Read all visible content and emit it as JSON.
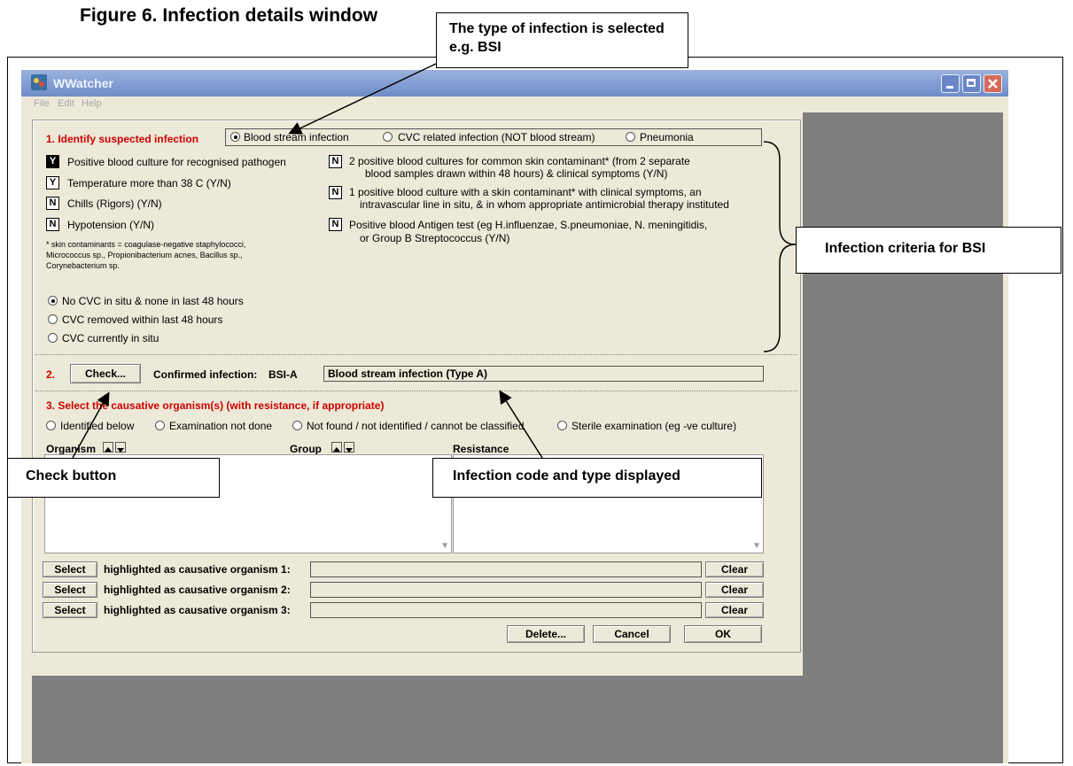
{
  "figure_title": "Figure 6. Infection details window",
  "callouts": {
    "type_selected": "The type of infection is selected e.g. BSI",
    "criteria": "Infection criteria for BSI",
    "check_button": "Check button",
    "code_type": "Infection code and type displayed"
  },
  "window": {
    "title": "WWatcher",
    "menu": [
      "File",
      "Edit",
      "Help"
    ]
  },
  "section1": {
    "label": "1. Identify suspected infection",
    "types": [
      {
        "label": "Blood stream infection",
        "selected": true
      },
      {
        "label": "CVC related infection (NOT blood stream)",
        "selected": false
      },
      {
        "label": "Pneumonia",
        "selected": false
      }
    ],
    "criteria_left": [
      {
        "value": "Y",
        "label": "Positive blood culture for recognised pathogen"
      },
      {
        "value": "Y",
        "label": "Temperature more than 38 C (Y/N)"
      },
      {
        "value": "N",
        "label": "Chills (Rigors) (Y/N)"
      },
      {
        "value": "N",
        "label": "Hypotension (Y/N)"
      }
    ],
    "criteria_right": [
      {
        "value": "N",
        "line1": "2 positive blood cultures for common skin contaminant* (from 2 separate",
        "line2": "blood samples drawn within 48 hours) & clinical symptoms (Y/N)"
      },
      {
        "value": "N",
        "line1": "1 positive blood culture with a skin contaminant* with clinical symptoms, an",
        "line2": "intravascular line in situ, & in whom appropriate antimicrobial therapy  instituted"
      },
      {
        "value": "N",
        "line1": "Positive blood Antigen test (eg H.influenzae, S.pneumoniae, N. meningitidis,",
        "line2": "or Group B Streptococcus (Y/N)"
      }
    ],
    "footnote": "* skin contaminants = coagulase-negative staphylococci, Micrococcus sp., Propionibacterium acnes, Bacillus sp., Corynebacterium sp.",
    "cvc_options": [
      {
        "label": "No CVC in situ & none in last 48 hours",
        "selected": true
      },
      {
        "label": "CVC removed within last 48 hours",
        "selected": false
      },
      {
        "label": "CVC currently in situ",
        "selected": false
      }
    ]
  },
  "section2": {
    "number": "2.",
    "check_label": "Check...",
    "confirmed_label": "Confirmed infection:",
    "code": "BSI-A",
    "type_text": "Blood stream infection (Type A)"
  },
  "section3": {
    "label": "3. Select the causative organism(s) (with resistance, if appropriate)",
    "options": [
      {
        "label": "Identified below",
        "selected": false
      },
      {
        "label": "Examination not done",
        "selected": false
      },
      {
        "label": "Not found / not identified / cannot be classified",
        "selected": false
      },
      {
        "label": "Sterile examination (eg -ve culture)",
        "selected": false
      }
    ],
    "col_organism": "Organism",
    "col_group": "Group",
    "col_resistance": "Resistance",
    "select_label": "Select",
    "clear_label": "Clear",
    "rows": [
      "highlighted as causative organism 1:",
      "highlighted as causative organism 2:",
      "highlighted as causative organism 3:"
    ]
  },
  "actions": {
    "delete": "Delete...",
    "cancel": "Cancel",
    "ok": "OK"
  },
  "colors": {
    "section_red": "#cc0000",
    "dialog_bg": "#ece9d8",
    "gray_area": "#7f7f7f"
  }
}
